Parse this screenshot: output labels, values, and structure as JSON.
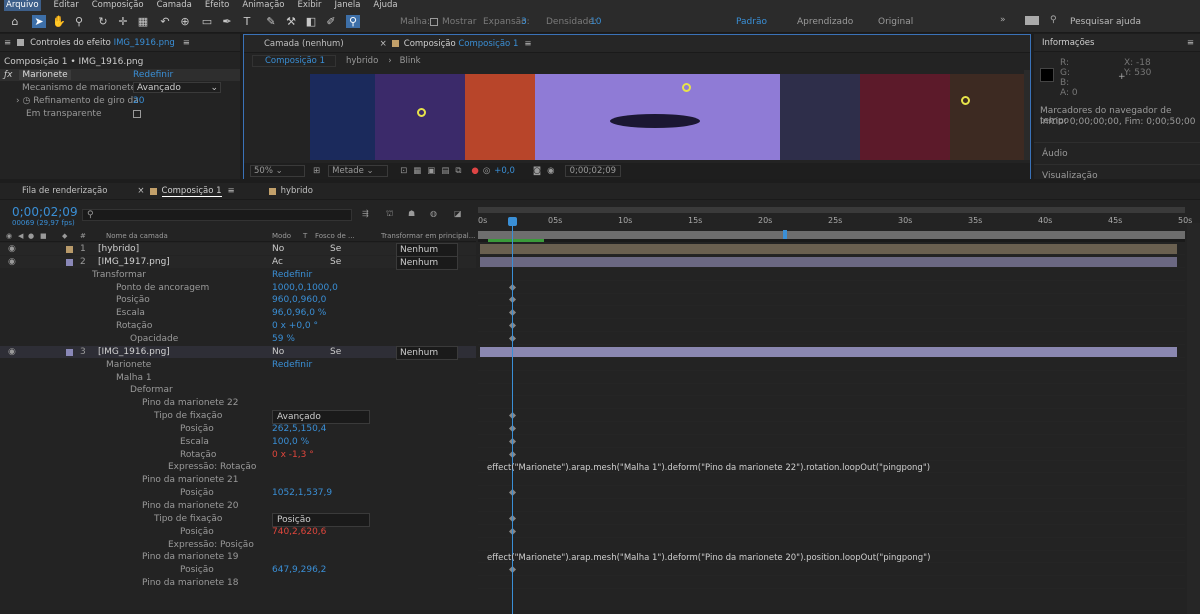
{
  "menu": [
    "Arquivo",
    "Editar",
    "Composição",
    "Camada",
    "Efeito",
    "Animação",
    "Exibir",
    "Janela",
    "Ajuda"
  ],
  "toolbar": {
    "malha_label": "Malha:",
    "mostrar_label": "Mostrar",
    "expansao_label": "Expansão:",
    "expansao_value": "3",
    "densidade_label": "Densidade:",
    "densidade_value": "10",
    "workspaces": [
      "Padrão",
      "Aprendizado",
      "Original"
    ],
    "search_placeholder": "Pesquisar ajuda"
  },
  "effect_controls": {
    "tab_label": "Controles do efeito",
    "tab_file": "IMG_1916.png",
    "path": "Composição 1 • IMG_1916.png",
    "fx_name": "Marionete",
    "reset": "Redefinir",
    "mesh_mech_label": "Mecanismo de marionetes",
    "mesh_mech_value": "Avançado",
    "refinement_label": "Refinamento de giro da",
    "refinement_value": "20",
    "transparent_label": "Em transparente"
  },
  "viewer": {
    "tab_layer": "Camada (nenhum)",
    "tab_comp": "Composição",
    "tab_comp_name": "Composição 1",
    "crumbs": [
      "Composição 1",
      "hybrido",
      "Blink"
    ],
    "zoom": "50%",
    "quality": "Metade",
    "exposure": "+0,0",
    "timecode": "0;00;02;09"
  },
  "info": {
    "title": "Informações",
    "r": "R:",
    "g": "G:",
    "b": "B:",
    "a": "A:",
    "a_value": "0",
    "x": "X: -18",
    "y": "Y: 530",
    "markers_title": "Marcadores do navegador de tempo",
    "markers_value": "Início: 0;00;00;00, Fim: 0;00;50;00",
    "audio": "Áudio",
    "visualizacao": "Visualização"
  },
  "timeline": {
    "tabs": [
      "Fila de renderização",
      "Composição 1",
      "hybrido"
    ],
    "timecode": "0;00;02;09",
    "frame_info": "00069 (29,97 fps)",
    "cols": {
      "num": "#",
      "name": "Nome da camada",
      "mode": "Modo",
      "t": "T",
      "matte": "Fosco de ...",
      "parent": "Transformar em principal..."
    },
    "ruler": [
      "0s",
      "05s",
      "10s",
      "15s",
      "20s",
      "25s",
      "30s",
      "35s",
      "40s",
      "45s",
      "50s"
    ],
    "rows": [
      {
        "indent": 88,
        "num": "1",
        "text": "[hybrido]",
        "mode": "No",
        "matte": "Se",
        "parent": "Nenhum",
        "layer": true
      },
      {
        "indent": 88,
        "num": "2",
        "text": "[IMG_1917.png]",
        "mode": "Ac",
        "matte": "Se",
        "parent": "Nenhum",
        "layer": true
      },
      {
        "indent": 82,
        "text": "Transformar",
        "value": "Redefinir"
      },
      {
        "indent": 106,
        "text": "Ponto de ancoragem",
        "value": "1000,0,1000,0"
      },
      {
        "indent": 106,
        "text": "Posição",
        "value": "960,0,960,0"
      },
      {
        "indent": 106,
        "text": "Escala",
        "value": "96,0,96,0 %"
      },
      {
        "indent": 106,
        "text": "Rotação",
        "value": "0 x +0,0 °"
      },
      {
        "indent": 120,
        "text": "Opacidade",
        "value": "59 %"
      },
      {
        "indent": 88,
        "num": "3",
        "text": "[IMG_1916.png]",
        "mode": "No",
        "matte": "Se",
        "parent": "Nenhum",
        "layer": true
      },
      {
        "indent": 96,
        "text": "Marionete",
        "value": "Redefinir"
      },
      {
        "indent": 106,
        "text": "Malha 1"
      },
      {
        "indent": 120,
        "text": "Deformar"
      },
      {
        "indent": 132,
        "text": "Pino da marionete 22"
      },
      {
        "indent": 144,
        "text": "Tipo de fixação",
        "value": "Avançado"
      },
      {
        "indent": 170,
        "text": "Posição",
        "value": "262,5,150,4"
      },
      {
        "indent": 170,
        "text": "Escala",
        "value": "100,0 %"
      },
      {
        "indent": 170,
        "text": "Rotação",
        "value": "0 x -1,3 °"
      },
      {
        "indent": 158,
        "text": "Expressão: Rotação"
      },
      {
        "indent": 132,
        "text": "Pino da marionete 21"
      },
      {
        "indent": 170,
        "text": "Posição",
        "value": "1052,1,537,9"
      },
      {
        "indent": 132,
        "text": "Pino da marionete 20"
      },
      {
        "indent": 144,
        "text": "Tipo de fixação",
        "value": "Posição"
      },
      {
        "indent": 170,
        "text": "Posição",
        "value": "740,2,620,6"
      },
      {
        "indent": 158,
        "text": "Expressão: Posição"
      },
      {
        "indent": 132,
        "text": "Pino da marionete 19"
      },
      {
        "indent": 170,
        "text": "Posição",
        "value": "647,9,296,2"
      },
      {
        "indent": 132,
        "text": "Pino da marionete 18"
      }
    ],
    "expr1": "effect(\"Marionete\").arap.mesh(\"Malha 1\").deform(\"Pino da marionete 22\").rotation.loopOut(\"pingpong\")",
    "expr2": "effect(\"Marionete\").arap.mesh(\"Malha 1\").deform(\"Pino da marionete 20\").position.loopOut(\"pingpong\")"
  },
  "colors": {
    "accent": "#3a8fd6",
    "value_red": "#e0463c",
    "layer_bar": "#6b6882",
    "layer_bar_sel": "#8a87b0"
  }
}
